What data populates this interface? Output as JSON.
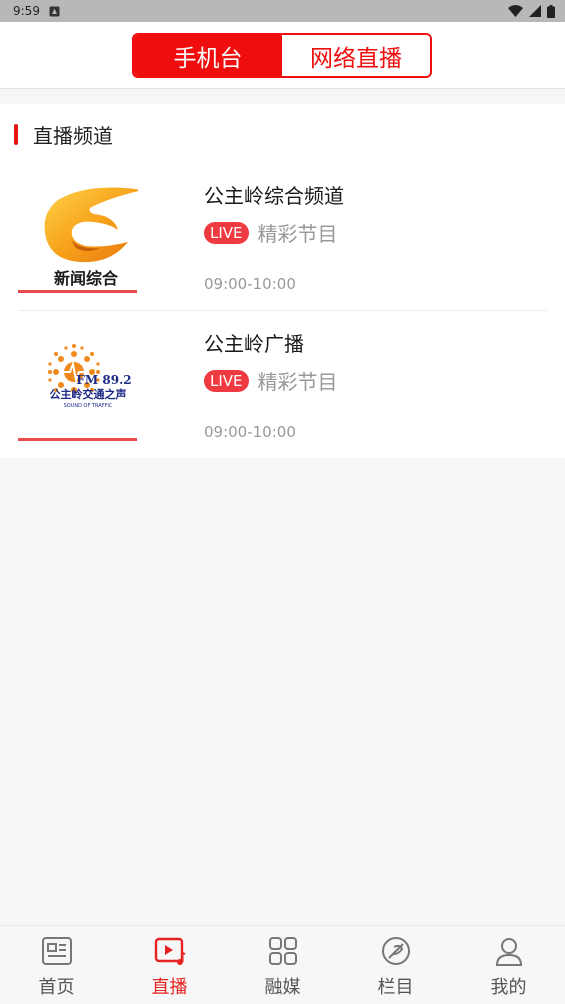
{
  "status_bar": {
    "time": "9:59"
  },
  "header": {
    "tabs": [
      {
        "label": "手机台",
        "active": true
      },
      {
        "label": "网络直播",
        "active": false
      }
    ],
    "accent_color": "#ef0d0d"
  },
  "section": {
    "title": "直播频道"
  },
  "channels": [
    {
      "name": "公主岭综合频道",
      "live_badge": "LIVE",
      "program": "精彩节目",
      "time": "09:00-10:00",
      "logo": {
        "icon": "news-channel-logo",
        "text": "新闻综合"
      }
    },
    {
      "name": "公主岭广播",
      "live_badge": "LIVE",
      "program": "精彩节目",
      "time": "09:00-10:00",
      "logo": {
        "icon": "radio-station-logo",
        "freq": "FM 89.2",
        "text": "公主岭交通之声",
        "sub": "SOUND OF TRAFFIC"
      }
    }
  ],
  "tabbar": {
    "items": [
      {
        "label": "首页",
        "icon": "news-icon",
        "active": false
      },
      {
        "label": "直播",
        "icon": "live-play-icon",
        "active": true
      },
      {
        "label": "融媒",
        "icon": "grid-icon",
        "active": false
      },
      {
        "label": "栏目",
        "icon": "column-icon",
        "active": false
      },
      {
        "label": "我的",
        "icon": "profile-icon",
        "active": false
      }
    ]
  }
}
